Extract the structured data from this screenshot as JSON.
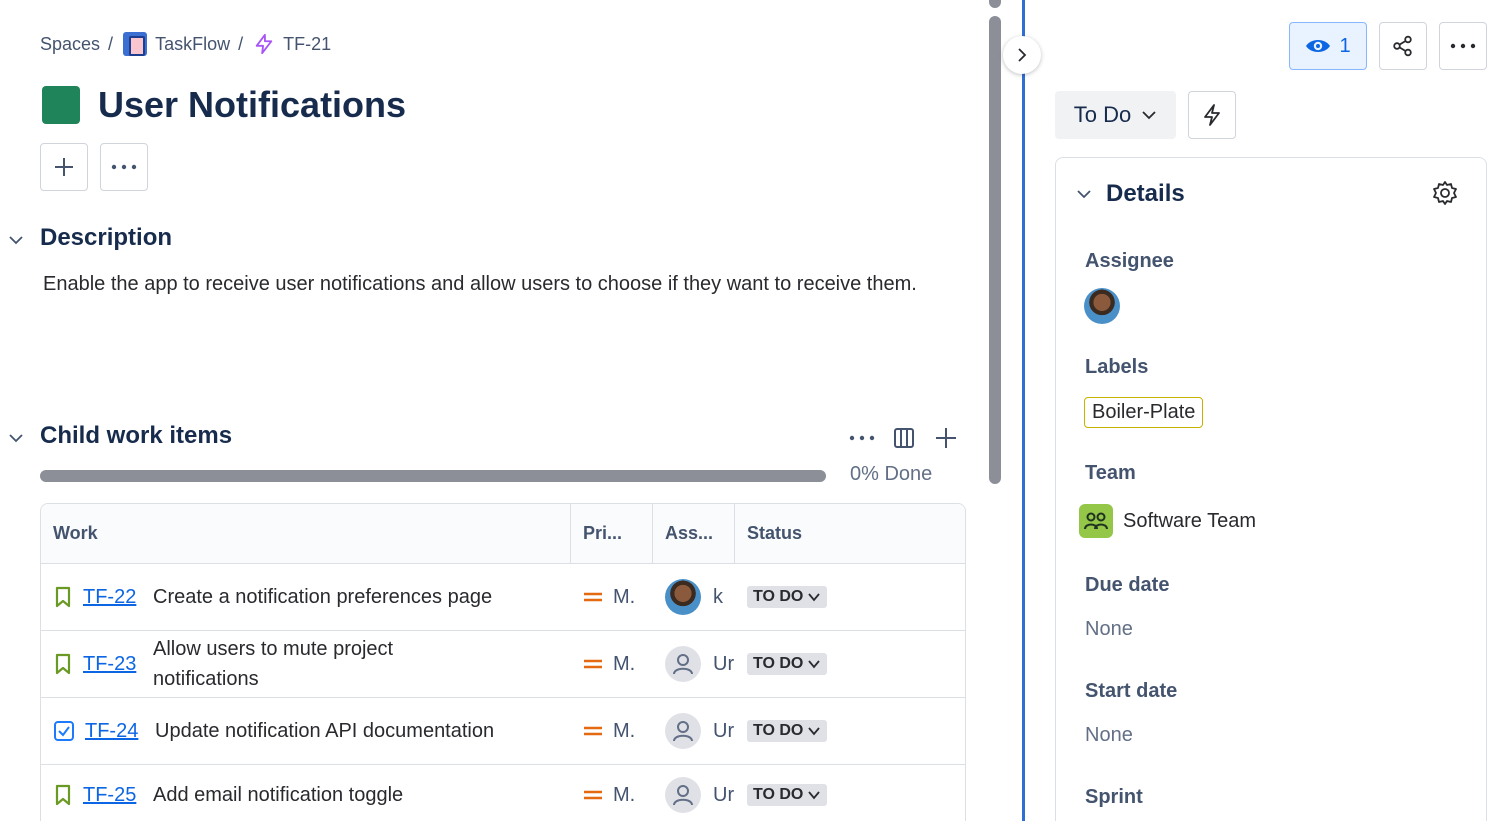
{
  "breadcrumb": {
    "spaces": "Spaces",
    "project": "TaskFlow",
    "issue": "TF-21",
    "separator": "/"
  },
  "issue": {
    "title": "User Notifications",
    "color": "#1f845a"
  },
  "description": {
    "heading": "Description",
    "text": "Enable the app to receive user notifications and allow users to choose if they want to receive them."
  },
  "child_items": {
    "heading": "Child work items",
    "progress_label": "0% Done",
    "progress_fraction": 0,
    "columns": {
      "work": "Work",
      "priority": "Pri...",
      "assignee": "Ass...",
      "status": "Status"
    },
    "rows": [
      {
        "key": "TF-22",
        "summary": "Create a notification preferences page",
        "type": "story-icon",
        "priority": "M.",
        "assignee": "k",
        "assignee_avatar": "photo",
        "status": "TO DO"
      },
      {
        "key": "TF-23",
        "summary": "Allow users to mute project notifications",
        "type": "story-icon",
        "priority": "M.",
        "assignee": "Ur",
        "assignee_avatar": "empty",
        "status": "TO DO"
      },
      {
        "key": "TF-24",
        "summary": "Update notification API documentation",
        "type": "task-icon",
        "priority": "M.",
        "assignee": "Ur",
        "assignee_avatar": "empty",
        "status": "TO DO"
      },
      {
        "key": "TF-25",
        "summary": "Add email notification toggle",
        "type": "story-icon",
        "priority": "M.",
        "assignee": "Ur",
        "assignee_avatar": "empty",
        "status": "TO DO"
      }
    ]
  },
  "right_panel": {
    "watchers": "1",
    "status": "To Do",
    "details_heading": "Details",
    "fields": {
      "assignee_label": "Assignee",
      "labels_label": "Labels",
      "label_value": "Boiler-Plate",
      "team_label": "Team",
      "team_value": "Software Team",
      "due_label": "Due date",
      "due_value": "None",
      "start_label": "Start date",
      "start_value": "None",
      "sprint_label": "Sprint"
    }
  },
  "colors": {
    "accent": "#0c66e4",
    "divider": "#2f6fd4",
    "priority_medium": "#e56910",
    "story_green": "#6a9a23"
  }
}
